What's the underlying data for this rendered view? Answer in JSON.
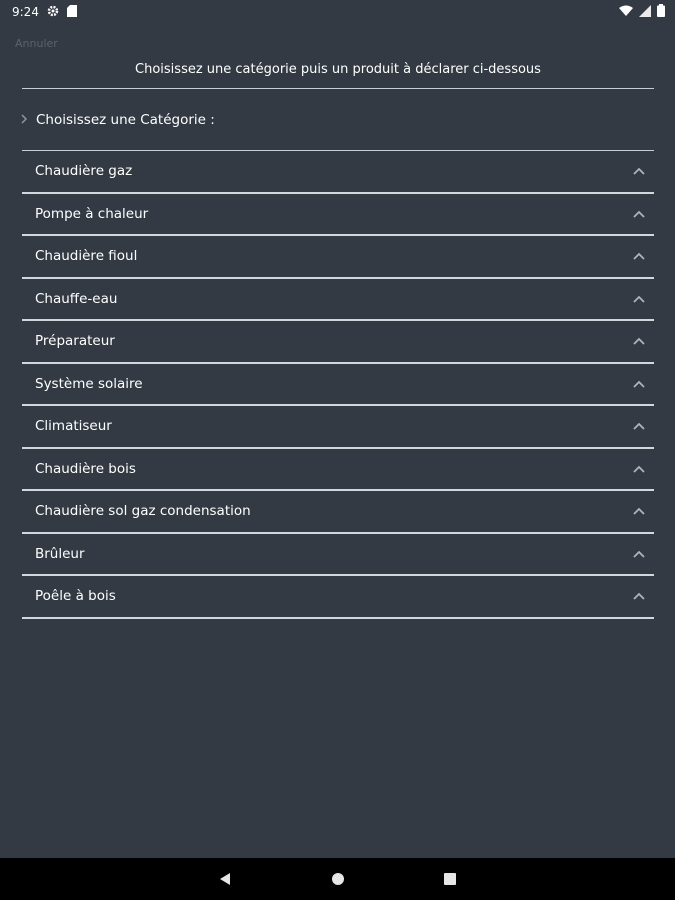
{
  "status": {
    "time": "9:24"
  },
  "cancel_label": "Annuler",
  "header": {
    "title": "Choisissez une catégorie puis un produit à déclarer ci-dessous"
  },
  "category_label": "Choisissez une Catégorie :",
  "categories": [
    "Chaudière gaz",
    "Pompe à chaleur",
    "Chaudière fioul",
    "Chauffe-eau",
    "Préparateur",
    "Système solaire",
    "Climatiseur",
    "Chaudière bois",
    "Chaudière sol gaz condensation",
    "Brûleur",
    "Poêle à bois"
  ],
  "icons": {
    "row_toggle": "chevron-up-icon",
    "category_head": "chevron-right-icon"
  },
  "colors": {
    "background": "#333a44",
    "divider": "#d3d6da",
    "nav": "#000000"
  }
}
